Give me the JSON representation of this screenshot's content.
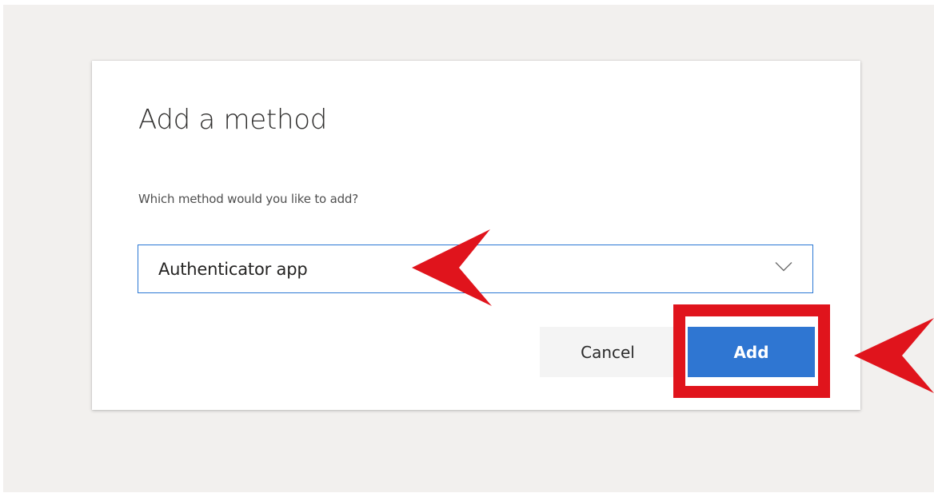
{
  "dialog": {
    "title": "Add a method",
    "prompt": "Which method would you like to add?",
    "method_select": {
      "selected_value": "Authenticator app",
      "icon": "chevron-down-icon"
    },
    "buttons": {
      "cancel_label": "Cancel",
      "add_label": "Add"
    }
  },
  "annotations": {
    "highlight_target": "add-button",
    "arrow_targets": [
      "method-select",
      "add-button"
    ],
    "color": "#e0141c"
  },
  "colors": {
    "accent": "#2f76d2",
    "select_border": "#2b78d4",
    "backdrop": "#f2f0ee",
    "annotation_red": "#e0141c"
  }
}
